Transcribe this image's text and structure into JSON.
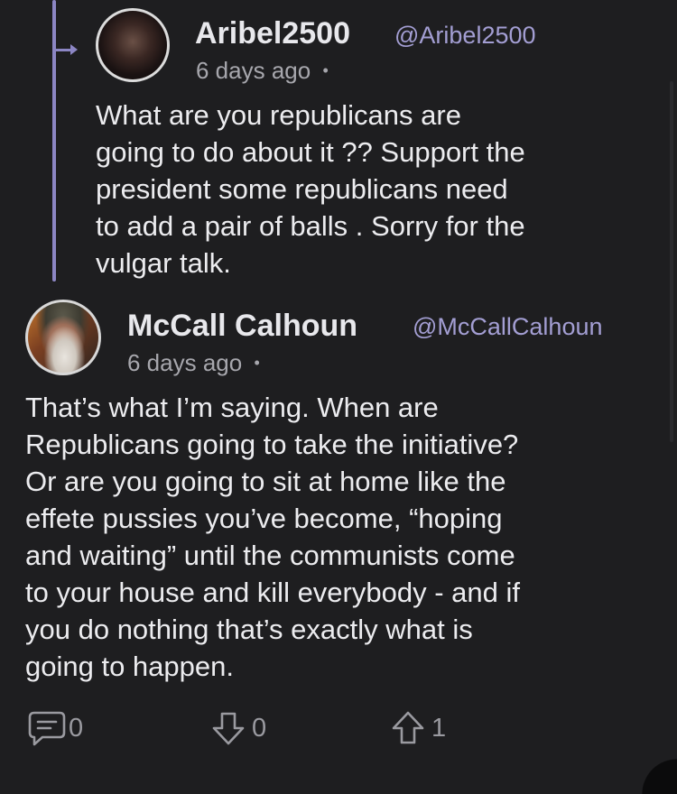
{
  "reply_parent": {
    "username": "Aribel2500",
    "handle": "@Aribel2500",
    "time": "6 days ago",
    "separator": "•",
    "body": "What are you republicans are\ngoing to do about it ?? Support the\npresident some republicans need\nto add a pair of balls . Sorry for the\nvulgar talk."
  },
  "reply": {
    "username": "McCall Calhoun",
    "handle": "@McCallCalhoun",
    "time": "6 days ago",
    "separator": "•",
    "body": "That’s what I’m saying. When are\nRepublicans going to take the initiative?\nOr are you going to sit at home like the\neffete pussies you’ve become, “hoping\nand waiting” until the communists come\nto your house and kill everybody - and if\nyou do nothing that’s exactly what is\ngoing to happen."
  },
  "actions": {
    "comments": "0",
    "downvotes": "0",
    "upvotes": "1"
  },
  "colors": {
    "background": "#1e1e20",
    "accent": "#8c86c4",
    "handle": "#a39ed3",
    "muted": "#9a9aa0"
  }
}
